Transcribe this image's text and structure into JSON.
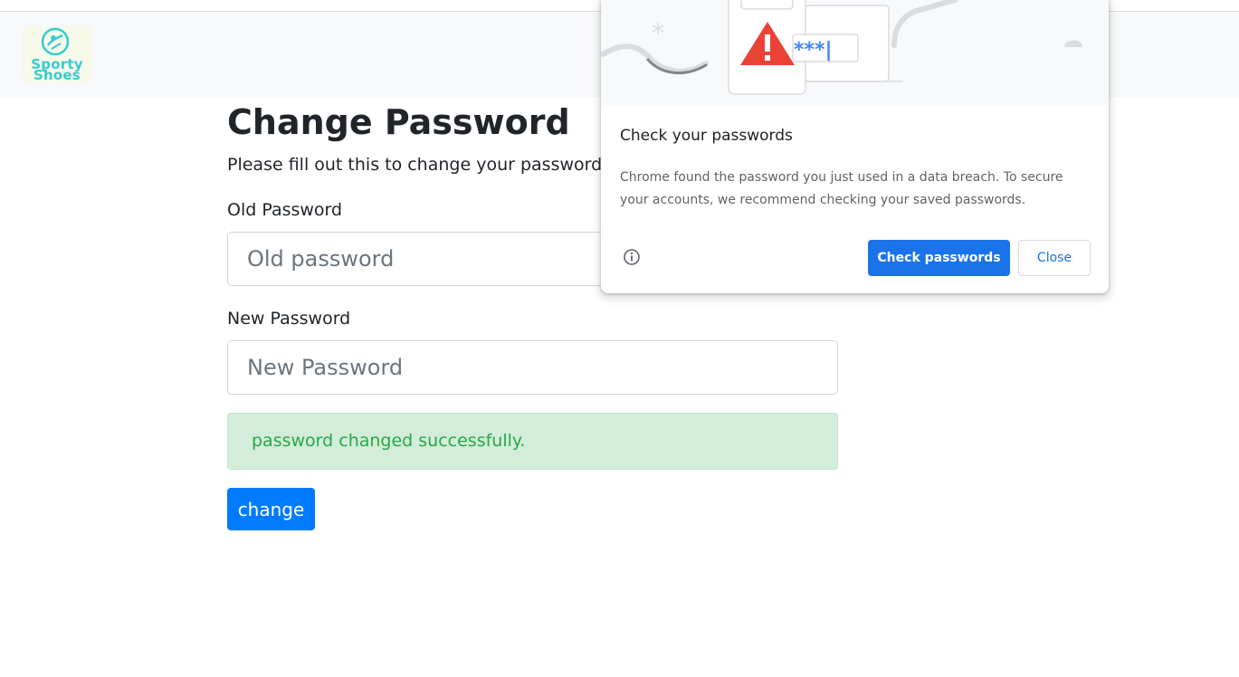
{
  "navbar": {
    "logo_text": "Sporty Shoes",
    "logo_color": "#36cbd3"
  },
  "form": {
    "title": "Change Password",
    "subtitle": "Please fill out this to change your password",
    "old_password_label": "Old Password",
    "old_password_placeholder": "Old password",
    "new_password_label": "New Password",
    "new_password_placeholder": "New Password",
    "success_message": "password changed successfully.",
    "submit_label": "change"
  },
  "popup": {
    "title": "Check your passwords",
    "body": "Chrome found the password you just used in a data breach. To secure your accounts, we recommend checking your saved passwords.",
    "masked_password": "***|",
    "check_button": "Check passwords",
    "close_button": "Close",
    "illustration": "warning-triangle-password-icon",
    "info_icon": "info-icon"
  },
  "colors": {
    "primary": "#007bff",
    "success_bg": "#d4edda",
    "success_text": "#28a745",
    "chrome_blue": "#1a73e8",
    "warning_red": "#ea4335"
  }
}
